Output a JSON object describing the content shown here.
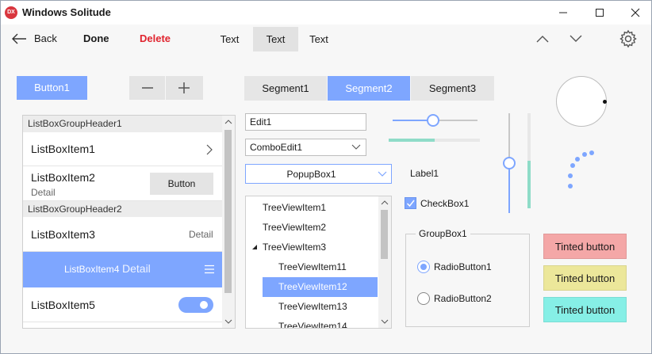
{
  "window": {
    "app_badge": "DX",
    "title": "Windows Solitude"
  },
  "toolbar": {
    "back_label": "Back",
    "done_label": "Done",
    "delete_label": "Delete",
    "text_buttons": [
      "Text",
      "Text",
      "Text"
    ]
  },
  "controls": {
    "button1_label": "Button1",
    "segments": [
      "Segment1",
      "Segment2",
      "Segment3"
    ],
    "selected_segment": "Segment2"
  },
  "listbox": {
    "group1": "ListBoxGroupHeader1",
    "group2": "ListBoxGroupHeader2",
    "item1": "ListBoxItem1",
    "item2": "ListBoxItem2",
    "item2_detail": "Detail",
    "item2_button": "Button",
    "item3": "ListBoxItem3",
    "item3_detail": "Detail",
    "item4": "ListBoxItem4",
    "item4_detail": "Detail",
    "item5": "ListBoxItem5",
    "item5_switch_on": true
  },
  "inputs": {
    "edit1": "Edit1",
    "combo1": "ComboEdit1",
    "popup1": "PopupBox1",
    "label1": "Label1",
    "checkbox1": "CheckBox1",
    "checkbox1_checked": true
  },
  "tree": {
    "items": [
      "TreeViewItem1",
      "TreeViewItem2",
      "TreeViewItem3",
      "TreeViewItem11",
      "TreeViewItem12",
      "TreeViewItem13",
      "TreeViewItem14"
    ],
    "selected": "TreeViewItem12"
  },
  "group": {
    "title": "GroupBox1",
    "radio1": "RadioButton1",
    "radio2": "RadioButton2",
    "radio1_selected": true
  },
  "tinted": {
    "red": "Tinted button",
    "yellow": "Tinted button",
    "cyan": "Tinted button"
  },
  "sliders": {
    "horizontal_value": 0.47,
    "progress_value": 0.5,
    "vertical_value": 0.5,
    "vertical_progress_value": 0.5
  },
  "colors": {
    "accent": "#7ea6ff",
    "delete_red": "#e0242e",
    "progress_teal": "#8fdcc8",
    "tinted_red": "#f4a7a7",
    "tinted_yellow": "#ece79a",
    "tinted_cyan": "#86efe6"
  }
}
